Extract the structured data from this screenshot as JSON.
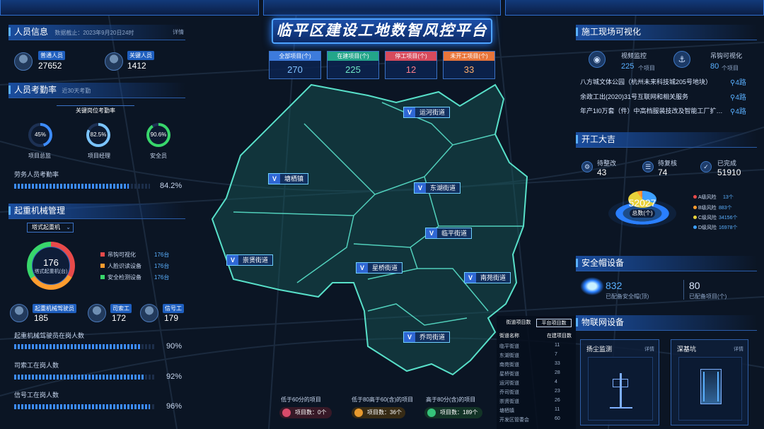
{
  "title": "临平区建设工地数智风控平台",
  "personnel": {
    "header": "人员信息",
    "date_note": "数据截止：2023年9月20日24时",
    "detail": "详情",
    "normal_label": "普通人员",
    "normal_value": "27652",
    "key_label": "关键人员",
    "key_value": "1412"
  },
  "attendance": {
    "header": "人员考勤率",
    "sub": "近30天考勤",
    "key_title": "关键岗位考勤率",
    "rings": [
      {
        "label": "项目总监",
        "value": "45%",
        "percent": 45
      },
      {
        "label": "项目经理",
        "value": "82.5%",
        "percent": 82.5
      },
      {
        "label": "安全员",
        "value": "90.6%",
        "percent": 90.6
      }
    ],
    "labor_label": "劳务人员考勤率",
    "labor_value": "84.2%",
    "labor_percent": 84.2
  },
  "crane": {
    "header": "起重机械管理",
    "select": "塔式起重机",
    "donut_value": "176",
    "donut_label": "塔式起重机(台)",
    "legend": [
      {
        "label": "吊钩可视化",
        "value": "176台",
        "color": "#e84a4a"
      },
      {
        "label": "人脸识读设备",
        "value": "176台",
        "color": "#ff9c2e"
      },
      {
        "label": "安全检测设备",
        "value": "176台",
        "color": "#38d66b"
      }
    ],
    "workers": [
      {
        "label": "起重机械驾驶员",
        "value": "185"
      },
      {
        "label": "司索工",
        "value": "172"
      },
      {
        "label": "信号工",
        "value": "179"
      }
    ],
    "bars": [
      {
        "label": "起重机械驾驶员在岗人数",
        "value": "90%",
        "percent": 90
      },
      {
        "label": "司索工在岗人数",
        "value": "92%",
        "percent": 92
      },
      {
        "label": "信号工在岗人数",
        "value": "96%",
        "percent": 96
      }
    ]
  },
  "stats": [
    {
      "label": "全部项目(个)",
      "value": "270",
      "color": "#3d7bdc"
    },
    {
      "label": "在建项目(个)",
      "value": "225",
      "color": "#23a58a"
    },
    {
      "label": "停工项目(个)",
      "value": "12",
      "color": "#d74a5c"
    },
    {
      "label": "未开工项目(个)",
      "value": "33",
      "color": "#e8753a"
    }
  ],
  "map": {
    "streets": [
      "运河街道",
      "塘栖镇",
      "东湖街道",
      "临平街道",
      "崇贤街道",
      "星桥街道",
      "南苑街道",
      "乔司街道"
    ],
    "tabs": [
      "街道项目数",
      "平台项目数"
    ],
    "table_headers": [
      "街道名称",
      "在建项目数"
    ],
    "table_rows": [
      [
        "临平街道",
        "11"
      ],
      [
        "东湖街道",
        "7"
      ],
      [
        "南苑街道",
        "33"
      ],
      [
        "星桥街道",
        "28"
      ],
      [
        "运河街道",
        "4"
      ],
      [
        "乔司街道",
        "23"
      ],
      [
        "崇贤街道",
        "26"
      ],
      [
        "塘栖镇",
        "11"
      ],
      [
        "开发区管委会",
        "60"
      ]
    ],
    "legend": [
      {
        "title": "低于60分的项目",
        "label": "项目数：0个",
        "color": "#d94b6b"
      },
      {
        "title": "低于80高于60(含)的项目",
        "label": "项目数：36个",
        "color": "#e89a2e"
      },
      {
        "title": "高于80分(含)的项目",
        "label": "项目数：189个",
        "color": "#35c47a"
      }
    ]
  },
  "site": {
    "header": "施工现场可视化",
    "video_label": "视频监控",
    "video_value": "225",
    "video_unit": "个项目",
    "hook_label": "吊钩可视化",
    "hook_value": "80",
    "hook_unit": "个项目",
    "list": [
      {
        "name": "八方城文体公园（杭州未来科技城205号地块）",
        "route": "4路"
      },
      {
        "name": "余政工出(2020)31号互联网和相关服务",
        "route": "4路"
      },
      {
        "name": "年产1I0万套（件）中高档服装技改及智能工厂扩…",
        "route": "4路"
      }
    ]
  },
  "kaigong": {
    "header": "开工大吉",
    "items": [
      {
        "label": "待整改",
        "value": "43"
      },
      {
        "label": "待复核",
        "value": "74"
      },
      {
        "label": "已完成",
        "value": "51910"
      }
    ],
    "total": "52027",
    "total_label": "总数(个)",
    "legend": [
      {
        "label": "A级风险",
        "value": "13个",
        "color": "#e84a4a"
      },
      {
        "label": "B级风险",
        "value": "883个",
        "color": "#ff9c2e"
      },
      {
        "label": "C级风险",
        "value": "34156个",
        "color": "#e8d23a"
      },
      {
        "label": "D级风险",
        "value": "16978个",
        "color": "#3da0ff"
      }
    ]
  },
  "helmet": {
    "header": "安全帽设备",
    "equipped": "832",
    "equipped_label": "已配备安全帽(顶)",
    "configured": "80",
    "configured_label": "已配备项目(个)"
  },
  "iot": {
    "header": "物联网设备",
    "cards": [
      {
        "title": "扬尘监测",
        "detail": "详情"
      },
      {
        "title": "深基坑",
        "detail": "详情"
      }
    ]
  }
}
